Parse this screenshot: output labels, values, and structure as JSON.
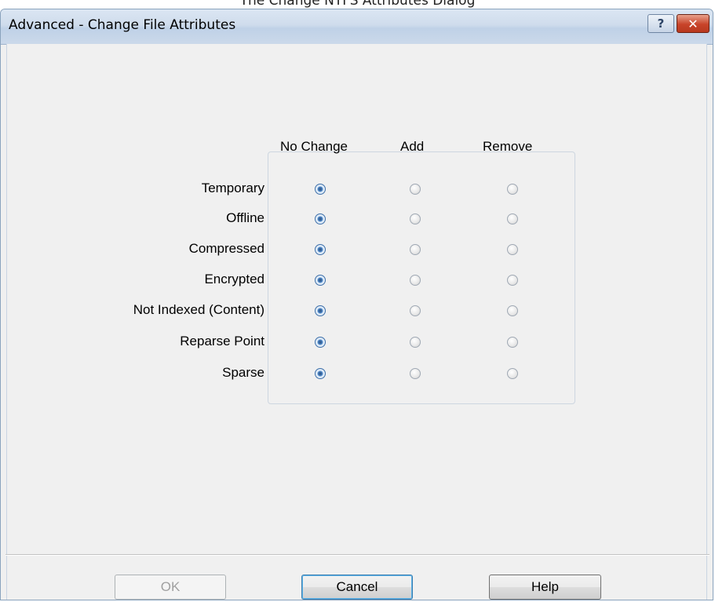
{
  "caption": "The Change NTFS Attributes Dialog",
  "window": {
    "title": "Advanced - Change File Attributes",
    "help_glyph": "?",
    "close_glyph": "✕"
  },
  "columns": [
    "No Change",
    "Add",
    "Remove"
  ],
  "attributes": [
    {
      "label": "Temporary",
      "selected": "No Change"
    },
    {
      "label": "Offline",
      "selected": "No Change"
    },
    {
      "label": "Compressed",
      "selected": "No Change"
    },
    {
      "label": "Encrypted",
      "selected": "No Change"
    },
    {
      "label": "Not Indexed  (Content)",
      "selected": "No Change"
    },
    {
      "label": "Reparse Point",
      "selected": "No Change"
    },
    {
      "label": "Sparse",
      "selected": "No Change"
    }
  ],
  "buttons": {
    "ok": "OK",
    "cancel": "Cancel",
    "help": "Help"
  },
  "colors": {
    "radio_selected": "#3c6ea8",
    "default_button_border": "#3c7fb1"
  }
}
